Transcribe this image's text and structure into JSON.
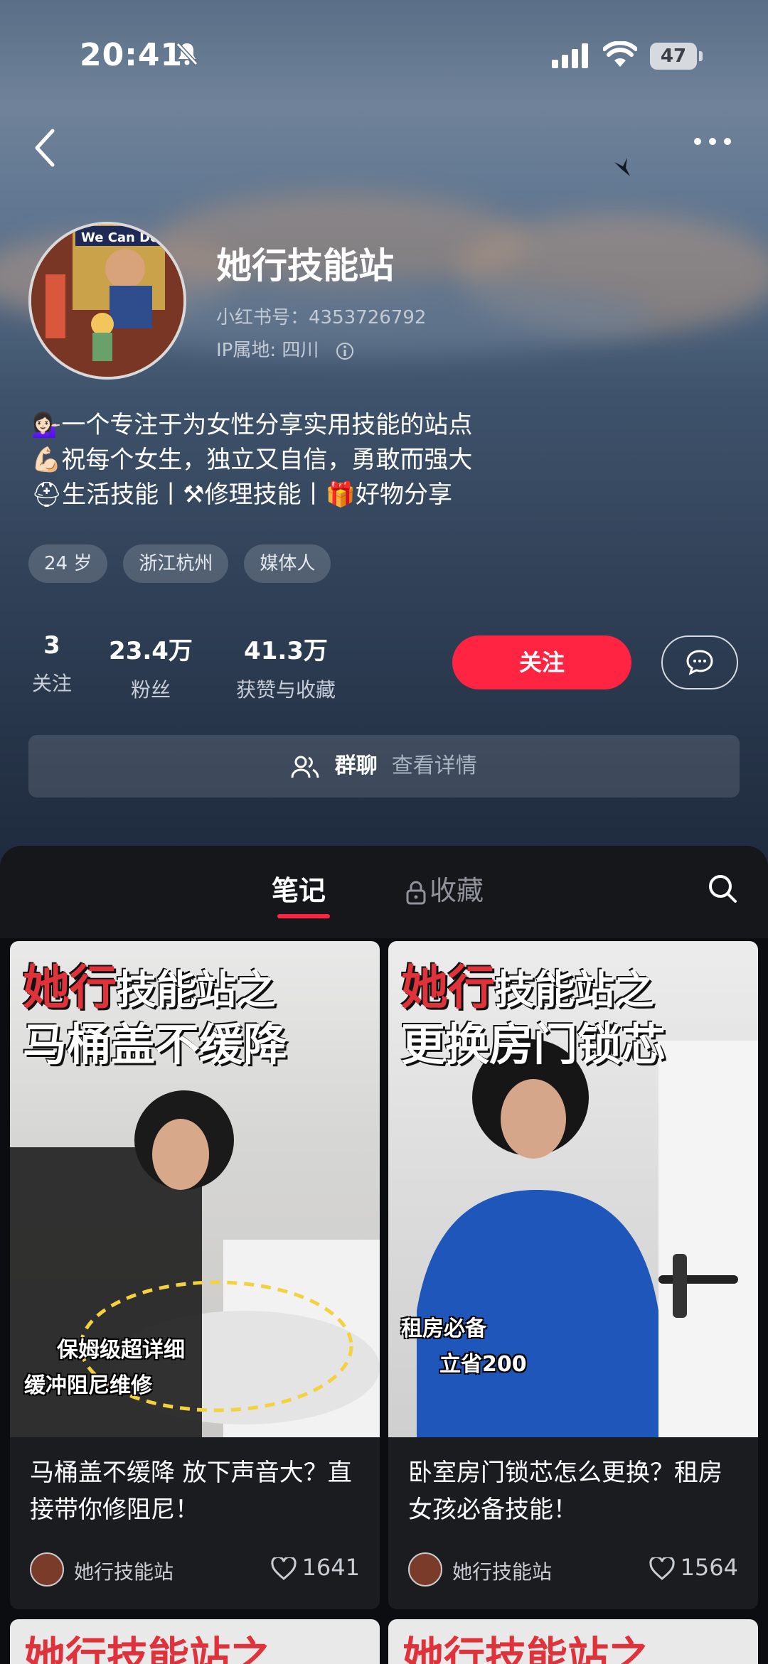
{
  "status_bar": {
    "time": "20:41",
    "battery": "47"
  },
  "profile": {
    "name": "她行技能站",
    "red_id": "小红书号：4353726792",
    "ip": "IP属地: 四川",
    "bio": [
      "一个专注于为女性分享实用技能的站点",
      "祝每个女生，独立又自信，勇敢而强大",
      "生活技能丨",
      "修理技能丨",
      "好物分享"
    ],
    "tags": [
      "24 岁",
      "浙江杭州",
      "媒体人"
    ],
    "stats": [
      {
        "value": "3",
        "label": "关注"
      },
      {
        "value": "23.4万",
        "label": "粉丝"
      },
      {
        "value": "41.3万",
        "label": "获赞与收藏"
      }
    ],
    "follow_label": "关注",
    "group_label": "群聊",
    "group_detail": "查看详情",
    "avatar_text": "We Can Do"
  },
  "tabs": {
    "notes": "笔记",
    "favorites": "收藏"
  },
  "notes": [
    {
      "cover_line1": "她行",
      "cover_line1b": "技能站之",
      "cover_line2": "马桶盖不缓降",
      "cover_caption1": "保姆级超详细",
      "cover_caption2": "缓冲阻尼维修",
      "title": "马桶盖不缓降 放下声音大？直接带你修阻尼！",
      "author": "她行技能站",
      "likes": "1641"
    },
    {
      "cover_line1": "她行",
      "cover_line1b": "技能站之",
      "cover_line2": "更换房门锁芯",
      "cover_caption1": "租房必备",
      "cover_caption2": "立省200",
      "title": "卧室房门锁芯怎么更换？租房女孩必备技能！",
      "author": "她行技能站",
      "likes": "1564"
    }
  ],
  "peek": [
    "她行技能站之",
    "她行技能站之"
  ],
  "colors": {
    "accent": "#ff2442",
    "background": "#0c0d10"
  }
}
